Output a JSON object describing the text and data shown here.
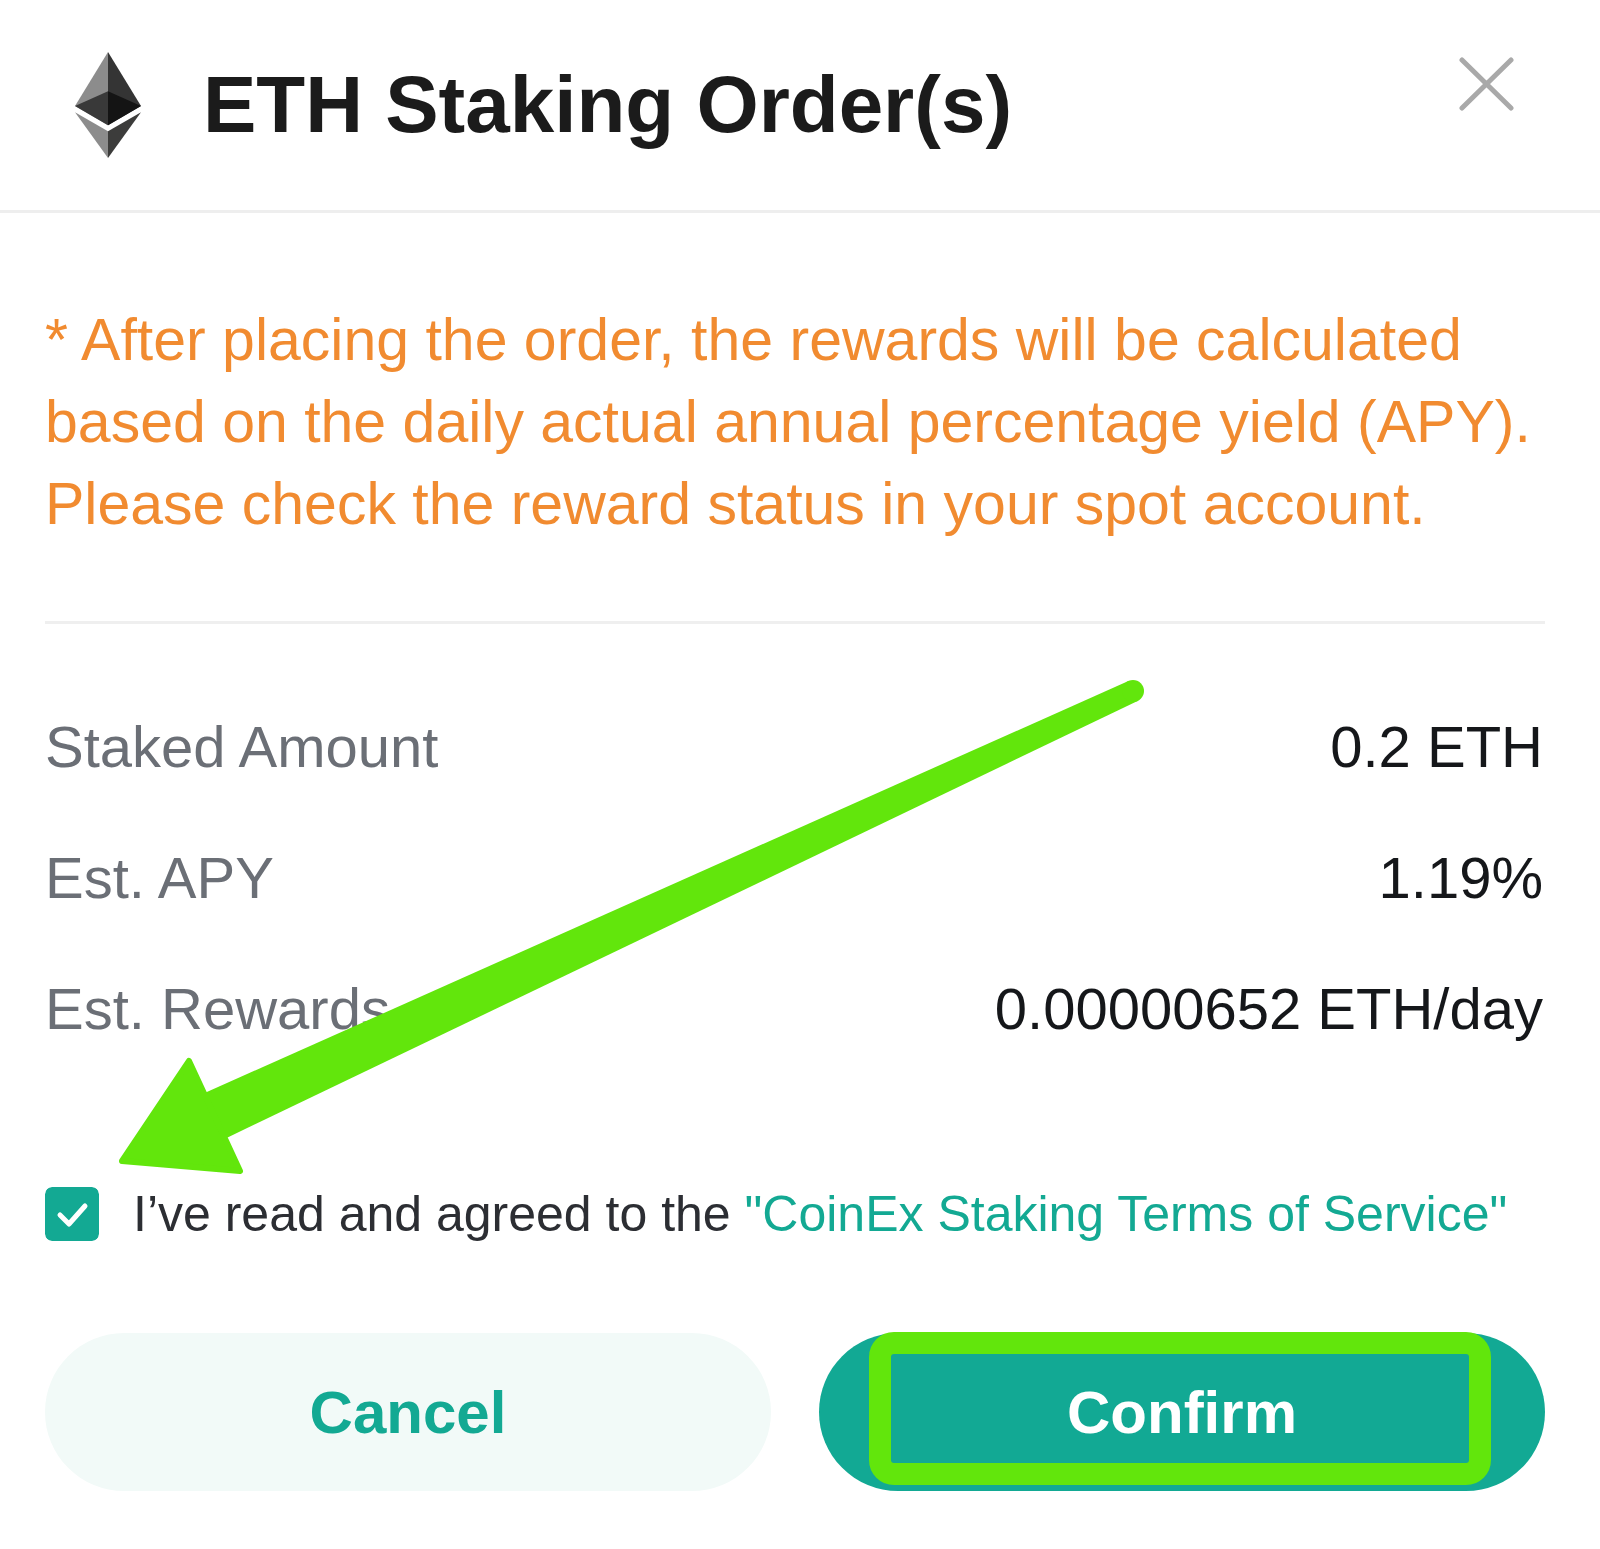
{
  "dialog": {
    "title": "ETH Staking Order(s)"
  },
  "notice": "* After placing the order, the rewards will be calculated based on the daily actual annual percentage yield (APY). Please check the reward status in your spot account.",
  "details": [
    {
      "label": "Staked Amount",
      "value": "0.2 ETH"
    },
    {
      "label": "Est. APY",
      "value": "1.19%"
    },
    {
      "label": "Est. Rewards",
      "value": "0.00000652 ETH/day"
    }
  ],
  "agreement": {
    "checked": true,
    "text": "I’ve read and agreed to the",
    "link": "\"CoinEx Staking Terms of Service\""
  },
  "buttons": [
    {
      "label": "Cancel",
      "kind": "secondary"
    },
    {
      "label": "Confirm",
      "kind": "primary"
    }
  ],
  "annotations": {
    "arrow": true,
    "highlight_frame": true
  }
}
